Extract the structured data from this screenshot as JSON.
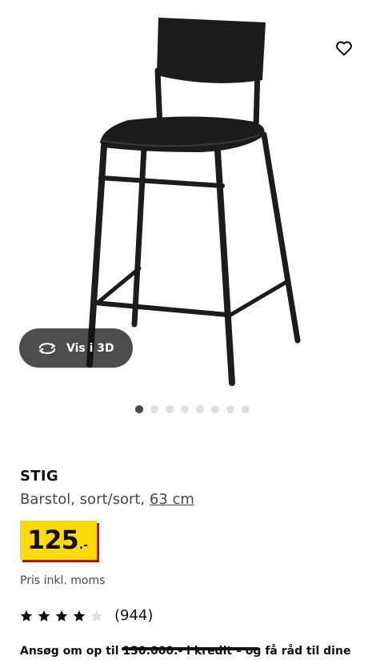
{
  "product": {
    "name": "STIG",
    "description": "Barstol, sort/sort, ",
    "size_link": "63 cm",
    "price_integer": "125",
    "price_suffix": ".-",
    "price_colors": {
      "background": "#ffdb00",
      "shadow": "#cc0008"
    },
    "vat_note": "Pris inkl. moms"
  },
  "gallery": {
    "view_3d_label": "Vis i 3D",
    "view_3d_icon": "rotate-3d-icon",
    "favorite_icon": "heart-icon",
    "image_count": 8,
    "active_index": 0
  },
  "rating": {
    "stars_filled": 4,
    "stars_total": 5,
    "count": "(944)"
  },
  "promo": {
    "text": "Ansøg om op til 130.000.- i kredit – og få råd til dine"
  }
}
